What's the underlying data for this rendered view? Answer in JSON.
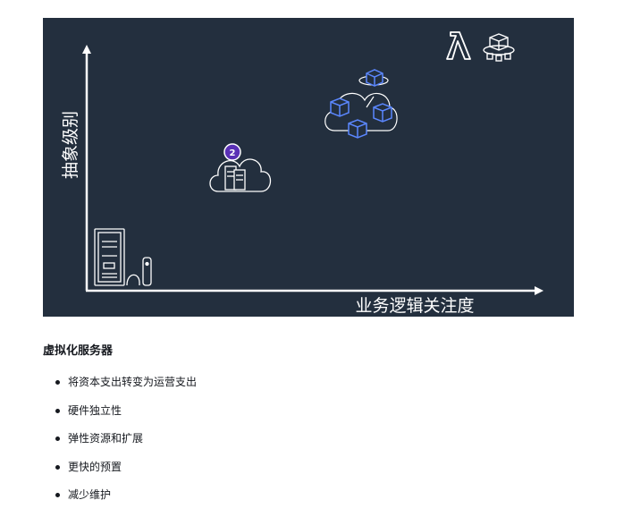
{
  "figure": {
    "y_axis_label": "抽象级别",
    "x_axis_label": "业务逻辑关注度",
    "badge_number": "2",
    "colors": {
      "background": "#232f3e",
      "axis": "#ffffff",
      "icon_stroke": "#ffffff",
      "cube_blue": "#5b87ff",
      "badge_purple": "#5a30b5"
    },
    "icons": [
      "physical-server-icon",
      "virtual-server-cloud-icon",
      "containers-cloud-icon",
      "lambda-icon",
      "serverless-cubes-icon"
    ]
  },
  "section": {
    "heading": "虚拟化服务器",
    "bullets": [
      "将资本支出转变为运营支出",
      "硬件独立性",
      "弹性资源和扩展",
      "更快的预置",
      "减少维护"
    ]
  }
}
